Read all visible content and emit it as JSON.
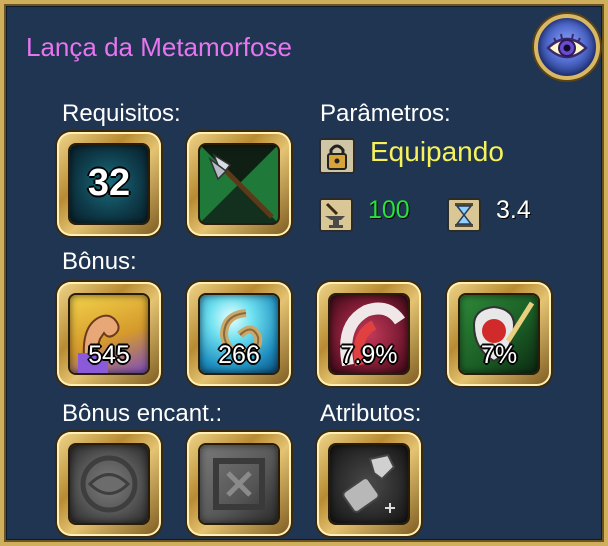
{
  "title": "Lança da Metamorfose",
  "sections": {
    "requirements": "Requisitos:",
    "parameters": "Parâmetros:",
    "bonus": "Bônus:",
    "enchant_bonus": "Bônus encant.:",
    "attributes": "Atributos:"
  },
  "requirements": {
    "level": "32",
    "weapon_type_icon": "spear-icon"
  },
  "parameters": {
    "equipping": "Equipando",
    "power_value": "100",
    "speed_value": "3.4",
    "lock_icon": "lock-icon",
    "power_icon": "anvil-icon",
    "speed_icon": "hourglass-icon"
  },
  "bonus": [
    {
      "icon": "strength-arm-icon",
      "value": "545"
    },
    {
      "icon": "agility-swirl-icon",
      "value": "266"
    },
    {
      "icon": "crit-slash-icon",
      "value": "7.9%"
    },
    {
      "icon": "lifesteal-shield-icon",
      "value": "7%"
    }
  ],
  "enchant_slots": [
    {
      "icon": "empty-gem-slot-icon"
    },
    {
      "icon": "empty-rune-slot-icon"
    }
  ],
  "attribute_slots": [
    {
      "icon": "gauntlet-icon"
    }
  ],
  "colors": {
    "title": "#e675ee",
    "equipping": "#f7f25a",
    "power": "#28e23a",
    "panel_bg": "#1f3552",
    "frame_gold": "#cfae5c"
  }
}
